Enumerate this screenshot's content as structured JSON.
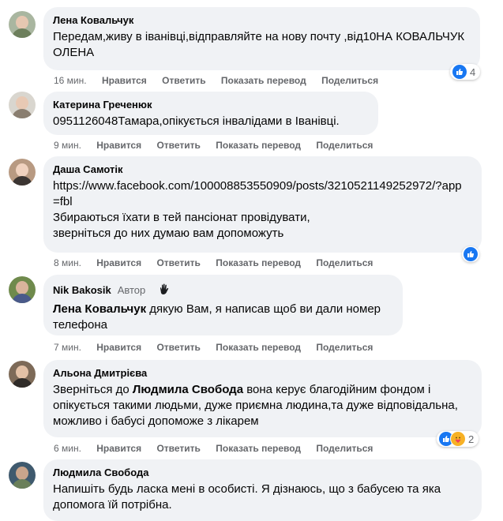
{
  "actions": {
    "like": "Нравится",
    "reply": "Ответить",
    "translate": "Показать перевод",
    "share": "Поделиться"
  },
  "colors": {
    "bubble": "#f0f2f5",
    "like": "#1877f2",
    "care": "#f7b125",
    "meta": "#65676b"
  },
  "comments": [
    {
      "author": "Лена Ковальчук",
      "text": "Передам,живу в іванівці,відправляйте на нову почту ,від10НА КОВАЛЬЧУК ОЛЕНА",
      "time": "16 мин.",
      "reactions": {
        "icons": [
          "like-icon"
        ],
        "count": "4"
      }
    },
    {
      "author": "Катерина Греченюк",
      "text": "0951126048Тамара,опікується інвалідами в Іванівці.",
      "time": "9 мин."
    },
    {
      "author": "Даша Самотік",
      "link": "https://www.facebook.com/100008853550909/posts/3210521149252972/?app=fbl",
      "text": "Збираються їхати в тей пансіонат провідувати, зверніться до них думаю вам допоможуть",
      "time": "8 мин.",
      "reactions": {
        "icons": [
          "like-icon"
        ],
        "count": ""
      }
    },
    {
      "author": "Nik Bakosik",
      "badge": "Автор",
      "mention": "Лена Ковальчук",
      "text": " дякую Вам, я написав щоб ви дали номер телефона",
      "time": "7 мин."
    },
    {
      "author": "Альона Дмитрієва",
      "text_before": "Зверніться до ",
      "mention": "Людмила Свобода",
      "text": " вона керує благодійним фондом і опікується такими людьми, дуже приємна людина,та дуже відповідальна, можливо і бабусі допоможе з лікарем",
      "time": "6 мин.",
      "reactions": {
        "icons": [
          "like-icon",
          "care-icon"
        ],
        "count": "2"
      }
    },
    {
      "author": "Людмила Свобода",
      "text": "Напишіть будь ласка мені в особисті. Я дізнаюсь, що з бабусею та яка допомога їй потрібна."
    }
  ]
}
